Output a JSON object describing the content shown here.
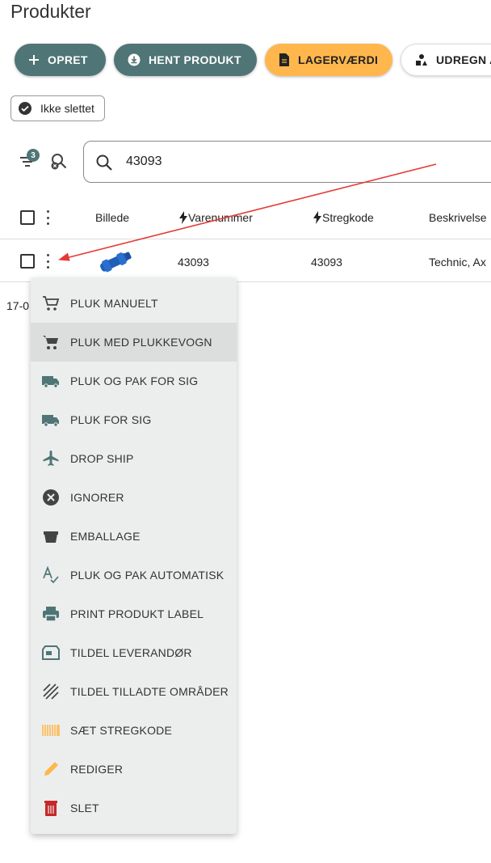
{
  "page": {
    "title": "Produkter"
  },
  "colors": {
    "primary": "#4f7576",
    "accent": "#ffb74d",
    "danger": "#c62828",
    "annotation_arrow": "#e53935"
  },
  "toolbar": {
    "create_label": "OPRET",
    "fetch_label": "HENT PRODUKT",
    "stock_value_label": "LAGERVÆRDI",
    "calculate_label": "UDREGN A"
  },
  "filters": {
    "chip_label": "Ikke slettet",
    "active_count": "3"
  },
  "search": {
    "value": "43093"
  },
  "table": {
    "headers": {
      "image": "Billede",
      "item_number": "Varenummer",
      "barcode": "Stregkode",
      "description": "Beskrivelse"
    },
    "rows": [
      {
        "item_number": "43093",
        "barcode": "43093",
        "description": "Technic, Ax"
      }
    ],
    "partial_text": "17-0"
  },
  "context_menu": {
    "items": [
      {
        "label": "PLUK MANUELT",
        "icon": "cart-outline-icon"
      },
      {
        "label": "PLUK MED PLUKKEVOGN",
        "icon": "cart-icon"
      },
      {
        "label": "PLUK OG PAK FOR SIG",
        "icon": "truck-icon"
      },
      {
        "label": "PLUK FOR SIG",
        "icon": "truck-icon"
      },
      {
        "label": "DROP SHIP",
        "icon": "airplane-icon"
      },
      {
        "label": "IGNORER",
        "icon": "cancel-circle-icon"
      },
      {
        "label": "EMBALLAGE",
        "icon": "basket-icon"
      },
      {
        "label": "PLUK OG PAK AUTOMATISK",
        "icon": "spellcheck-icon"
      },
      {
        "label": "PRINT PRODUKT LABEL",
        "icon": "printer-icon"
      },
      {
        "label": "TILDEL LEVERANDØR",
        "icon": "store-icon"
      },
      {
        "label": "TILDEL TILLADTE OMRÅDER",
        "icon": "hatched-area-icon"
      },
      {
        "label": "SÆT STREGKODE",
        "icon": "barcode-icon"
      },
      {
        "label": "REDIGER",
        "icon": "pencil-icon"
      },
      {
        "label": "SLET",
        "icon": "trash-icon"
      }
    ]
  }
}
